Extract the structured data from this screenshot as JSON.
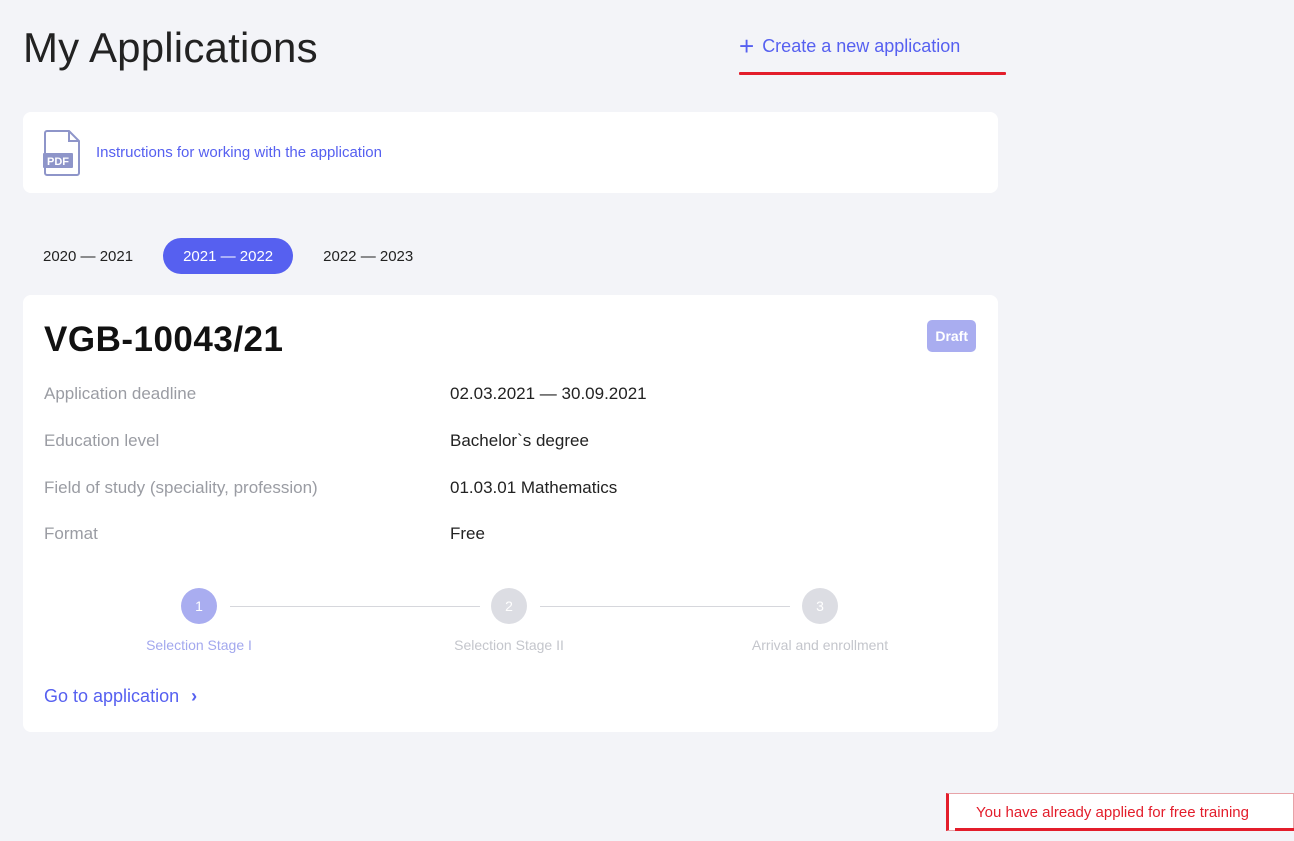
{
  "header": {
    "title": "My Applications",
    "create_icon": "plus-icon",
    "create_label": "Create a new application"
  },
  "instructions": {
    "icon": "pdf-icon",
    "icon_text": "PDF",
    "link_label": "Instructions for working with the application"
  },
  "year_tabs": [
    {
      "label": "2020 — 2021",
      "active": false
    },
    {
      "label": "2021 — 2022",
      "active": true
    },
    {
      "label": "2022 — 2023",
      "active": false
    }
  ],
  "application": {
    "number": "VGB-10043/21",
    "status": "Draft",
    "fields": [
      {
        "label": "Application deadline",
        "value": "02.03.2021 — 30.09.2021"
      },
      {
        "label": "Education level",
        "value": "Bachelor`s degree"
      },
      {
        "label": "Field of study (speciality, profession)",
        "value": "01.03.01 Mathematics"
      },
      {
        "label": "Format",
        "value": "Free"
      }
    ],
    "steps": [
      {
        "num": "1",
        "label": "Selection Stage I",
        "active": true
      },
      {
        "num": "2",
        "label": "Selection Stage II",
        "active": false
      },
      {
        "num": "3",
        "label": "Arrival and enrollment",
        "active": false
      }
    ],
    "go_label": "Go to application",
    "go_icon": "chevron-right-icon"
  },
  "toast": {
    "message": "You have already applied for free training"
  },
  "colors": {
    "accent": "#5660f0",
    "error": "#e31d2b",
    "badge": "#a9adf0",
    "step_active": "#a9adf0",
    "step_inactive": "#dcdde3"
  }
}
